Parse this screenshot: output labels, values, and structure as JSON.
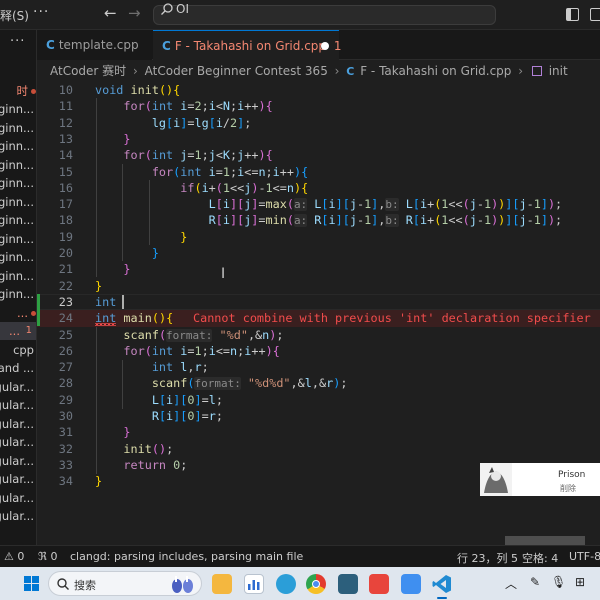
{
  "titlebar": {
    "menu_label": "释(S)",
    "more": "···",
    "back": "←",
    "forward": "→",
    "command_center": "OI"
  },
  "sidebar": {
    "more": "···",
    "items": [
      {
        "label": "时"
      },
      {
        "label": "ginn..."
      },
      {
        "label": "ginn..."
      },
      {
        "label": "ginn..."
      },
      {
        "label": "ginn..."
      },
      {
        "label": "ginn..."
      },
      {
        "label": "ginn..."
      },
      {
        "label": "ginn..."
      },
      {
        "label": "ginn..."
      },
      {
        "label": "ginn..."
      },
      {
        "label": "ginn..."
      },
      {
        "label": "ginn..."
      },
      {
        "label": "..."
      },
      {
        "label": "...",
        "badge": "1"
      },
      {
        "label": "cpp"
      },
      {
        "label": "and ..."
      },
      {
        "label": "egular..."
      },
      {
        "label": "egular..."
      },
      {
        "label": "egular..."
      },
      {
        "label": "egular..."
      },
      {
        "label": "egular..."
      },
      {
        "label": "egular..."
      },
      {
        "label": "egular..."
      },
      {
        "label": "egular..."
      }
    ]
  },
  "tabs": [
    {
      "label": "template.cpp",
      "icon": "C"
    },
    {
      "label": "F - Takahashi on Grid.cpp",
      "icon": "C",
      "badge": "1"
    }
  ],
  "breadcrumb": {
    "parts": [
      "AtCoder 赛时",
      "AtCoder Beginner Contest 365",
      "F - Takahashi on Grid.cpp",
      "init"
    ],
    "sep": "›",
    "cpp_icon": "C"
  },
  "editor": {
    "lines": [
      "10",
      "11",
      "12",
      "13",
      "14",
      "15",
      "16",
      "17",
      "18",
      "19",
      "20",
      "21",
      "22",
      "23",
      "24",
      "25",
      "26",
      "27",
      "28",
      "29",
      "30",
      "31",
      "32",
      "33",
      "34"
    ],
    "current_line": "23",
    "error_message": "Cannot combine with previous 'int' declaration specifier",
    "float_widget": {
      "title": "Prison",
      "subtitle": "削除"
    }
  },
  "statusbar": {
    "errors": "⊗ 0",
    "warnings": "⚠ 0",
    "ports": "ℜ 0",
    "clangd": "clangd: parsing includes, parsing main file",
    "position": "行 23，列 5",
    "spaces": "空格: 4",
    "encoding": "UTF-8"
  },
  "taskbar": {
    "search_placeholder": "搜索"
  },
  "colors": {
    "accent": "#0078d4",
    "error": "#f14c4c",
    "keyword": "#569cd6",
    "control": "#c586c0",
    "function": "#dcdcaa",
    "variable": "#9cdcfe"
  }
}
